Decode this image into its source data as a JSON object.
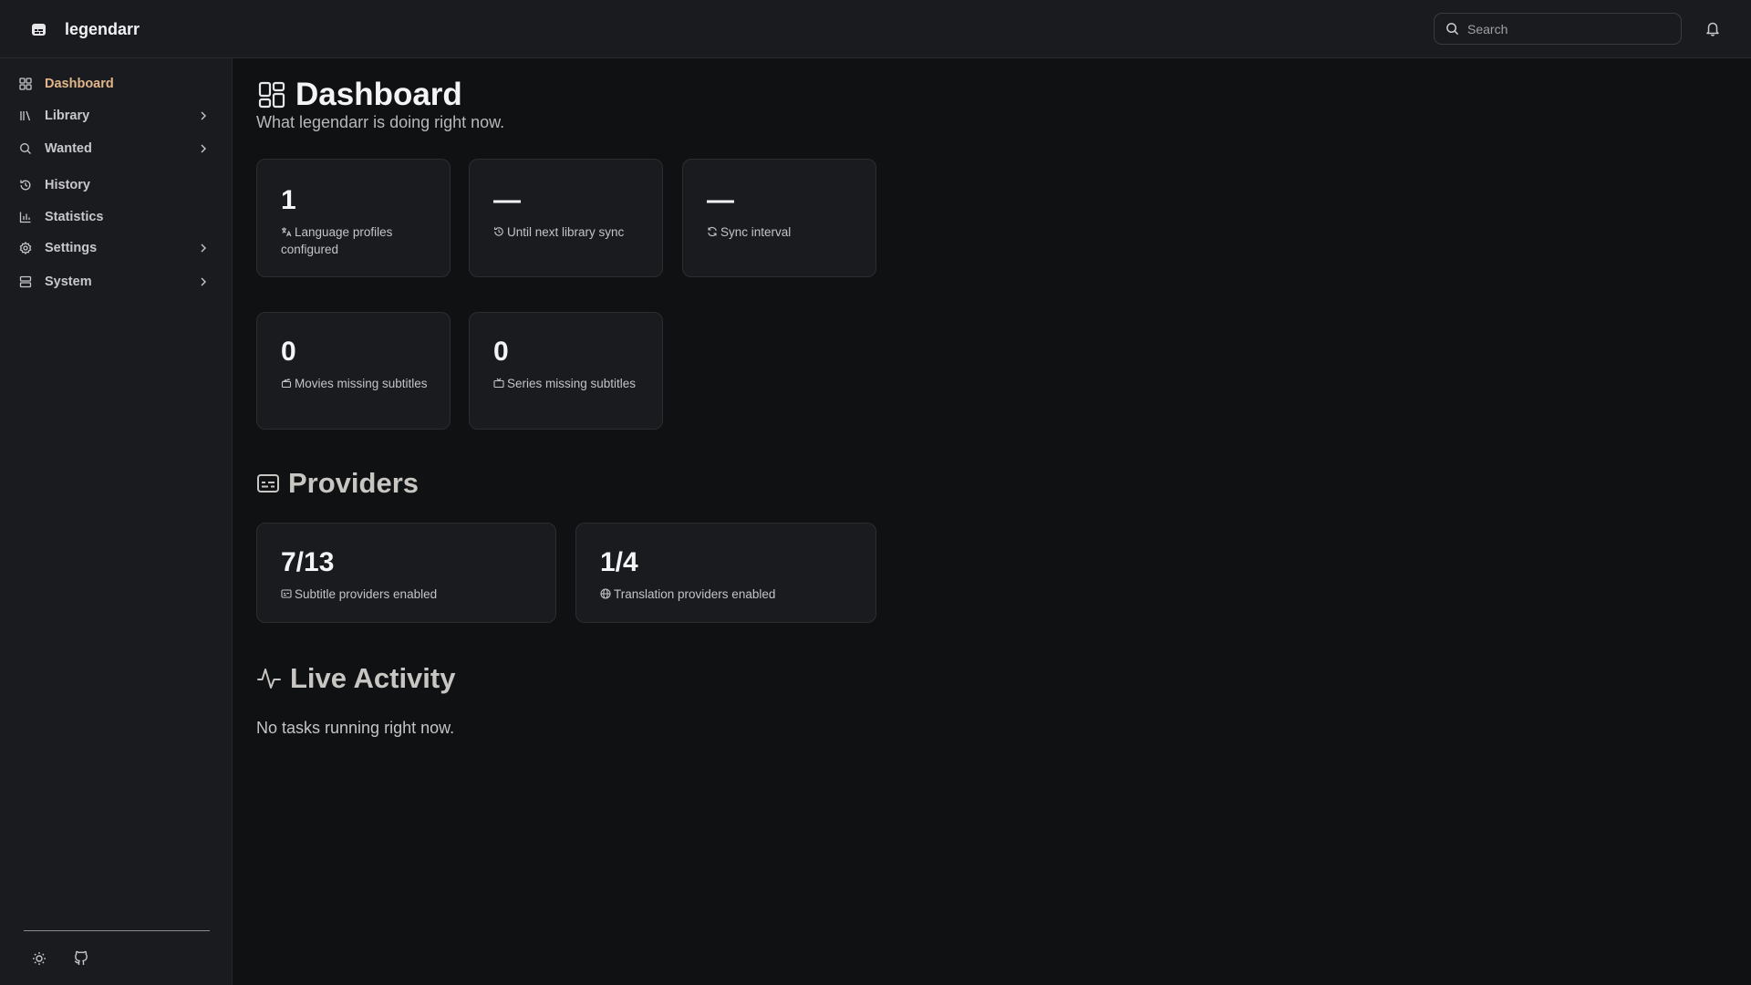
{
  "app": {
    "name": "legendarr"
  },
  "search": {
    "placeholder": "Search"
  },
  "sidebar": {
    "items": [
      {
        "label": "Dashboard"
      },
      {
        "label": "Library"
      },
      {
        "label": "Wanted"
      },
      {
        "label": "History"
      },
      {
        "label": "Statistics"
      },
      {
        "label": "Settings"
      },
      {
        "label": "System"
      }
    ]
  },
  "page": {
    "title": "Dashboard",
    "subtitle": "What legendarr is doing right now."
  },
  "stats": [
    {
      "value": "1",
      "label": "Language profiles configured"
    },
    {
      "value": "—",
      "label": "Until next library sync"
    },
    {
      "value": "—",
      "label": "Sync interval"
    },
    {
      "value": "0",
      "label": "Movies missing subtitles"
    },
    {
      "value": "0",
      "label": "Series missing subtitles"
    }
  ],
  "providers": {
    "title": "Providers",
    "cards": [
      {
        "value": "7/13",
        "label": "Subtitle providers enabled"
      },
      {
        "value": "1/4",
        "label": "Translation providers enabled"
      }
    ]
  },
  "activity": {
    "title": "Live Activity",
    "empty": "No tasks running right now."
  },
  "colors": {
    "accent": "#e3b58a",
    "background": "#101113",
    "panel": "#1a1b1e"
  },
  "icons": {
    "brand": "subtitles-logo-icon",
    "search": "search-icon",
    "notifications": "bell-icon",
    "theme": "sun-icon",
    "github": "github-icon"
  }
}
